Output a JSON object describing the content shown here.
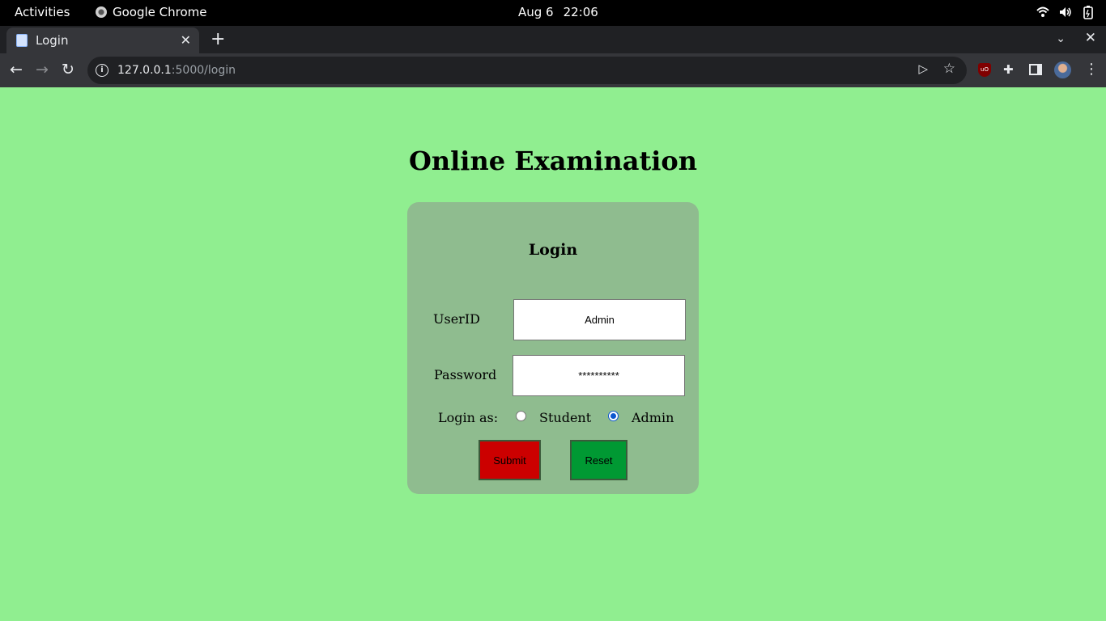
{
  "system_bar": {
    "activities": "Activities",
    "app_name": "Google Chrome",
    "date": "Aug 6",
    "time": "22:06"
  },
  "browser": {
    "tab_title": "Login",
    "url_host": "127.0.0.1",
    "url_path": ":5000/login"
  },
  "page": {
    "heading": "Online Examination",
    "form": {
      "title": "Login",
      "userid_label": "UserID",
      "userid_value": "Admin",
      "password_label": "Password",
      "password_value": "**********",
      "login_as_label": "Login as:",
      "role_options": [
        "Student",
        "Admin"
      ],
      "selected_role": "Admin",
      "submit_label": "Submit",
      "reset_label": "Reset"
    }
  },
  "colors": {
    "page_background": "#90ee90",
    "card_background": "#8fbc8f",
    "submit_button": "#cc0000",
    "reset_button": "#009933",
    "radio_accent": "#0b57d0"
  }
}
